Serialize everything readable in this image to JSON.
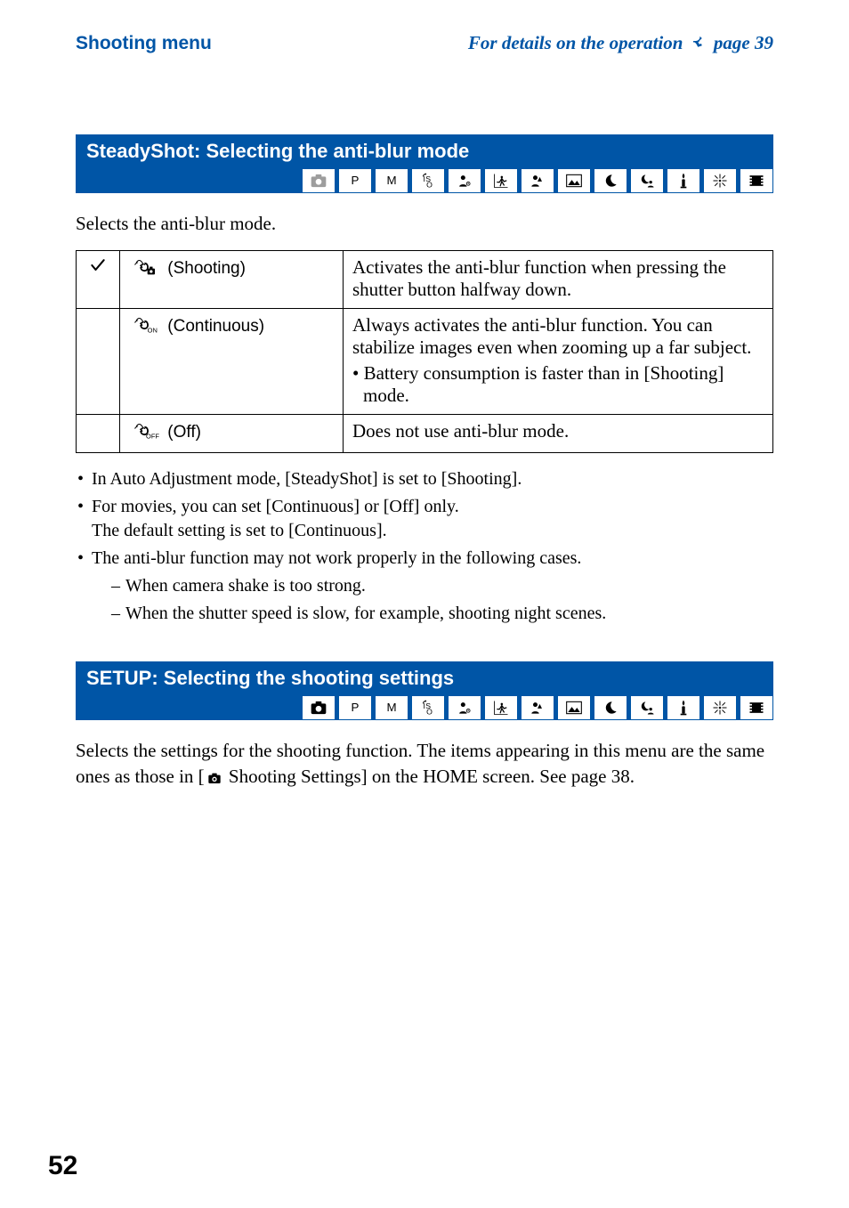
{
  "header": {
    "left": "Shooting menu",
    "right_prefix": "For details on the operation ",
    "right_page_ref": "page 39"
  },
  "sections": {
    "steadyshot": {
      "title": "SteadyShot: Selecting the anti-blur mode",
      "intro": "Selects the anti-blur mode.",
      "options": [
        {
          "checked": true,
          "icon": "steadyshot-shooting-icon",
          "label": "(Shooting)",
          "desc": "Activates the anti-blur function when pressing the shutter button halfway down."
        },
        {
          "checked": false,
          "icon": "steadyshot-continuous-icon",
          "label": "(Continuous)",
          "desc": "Always activates the anti-blur function. You can stabilize images even when zooming up a far subject.",
          "sub": "• Battery consumption is faster than in [Shooting] mode."
        },
        {
          "checked": false,
          "icon": "steadyshot-off-icon",
          "label": "(Off)",
          "desc": "Does not use anti-blur mode."
        }
      ],
      "notes": [
        "In Auto Adjustment mode, [SteadyShot] is set to [Shooting].",
        "For movies, you can set [Continuous] or [Off] only.",
        "The default setting is set to [Continuous].",
        "The anti-blur function may not work properly in the following cases.",
        "When camera shake is too strong.",
        "When the shutter speed is slow, for example, shooting night scenes."
      ]
    },
    "setup": {
      "title": "SETUP: Selecting the shooting settings",
      "body_pre": "Selects the settings for the shooting function. The items appearing in this menu are the same ones as those in [",
      "body_post": " Shooting Settings] on the HOME screen. See page 38."
    }
  },
  "mode_strip": {
    "modes": [
      {
        "name": "camera-auto-icon",
        "dim_for": [
          "steadyshot"
        ]
      },
      {
        "name": "program-p-icon"
      },
      {
        "name": "manual-m-icon"
      },
      {
        "name": "iso-icon"
      },
      {
        "name": "portrait-soft-icon"
      },
      {
        "name": "action-icon"
      },
      {
        "name": "portrait-icon"
      },
      {
        "name": "landscape-icon"
      },
      {
        "name": "moon-icon"
      },
      {
        "name": "twilight-portrait-icon"
      },
      {
        "name": "candle-icon"
      },
      {
        "name": "fireworks-icon"
      },
      {
        "name": "movie-icon"
      }
    ]
  },
  "page_number": "52"
}
